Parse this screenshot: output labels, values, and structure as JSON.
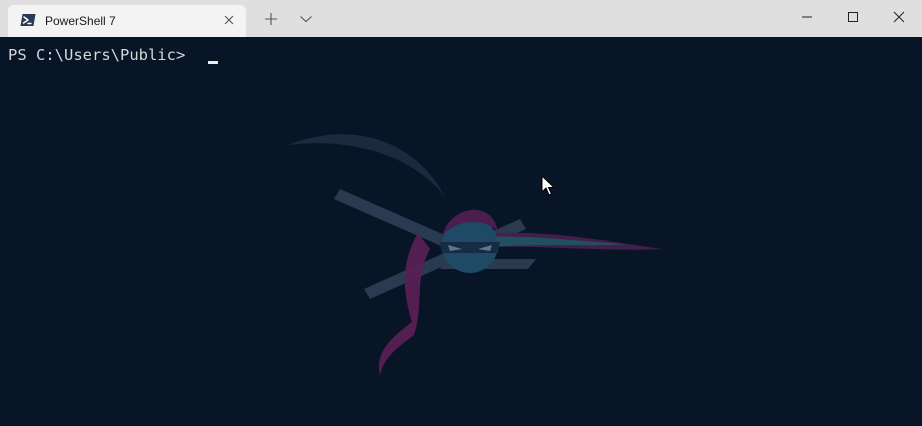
{
  "tab": {
    "title": "PowerShell 7",
    "icon": "powershell-icon"
  },
  "titlebar": {
    "new_tab_icon": "plus-icon",
    "dropdown_icon": "chevron-down-icon",
    "minimize_icon": "minimize-icon",
    "maximize_icon": "maximize-icon",
    "close_icon": "close-icon"
  },
  "terminal": {
    "prompt": "PS C:\\Users\\Public> ",
    "background_image": "ninja-cat-backdrop",
    "background_color": "#081527",
    "text_color": "#d6d6d6"
  },
  "colors": {
    "titlebar_bg": "#dfdfdf",
    "tab_bg": "#f3f3f3",
    "terminal_bg": "#081527"
  }
}
